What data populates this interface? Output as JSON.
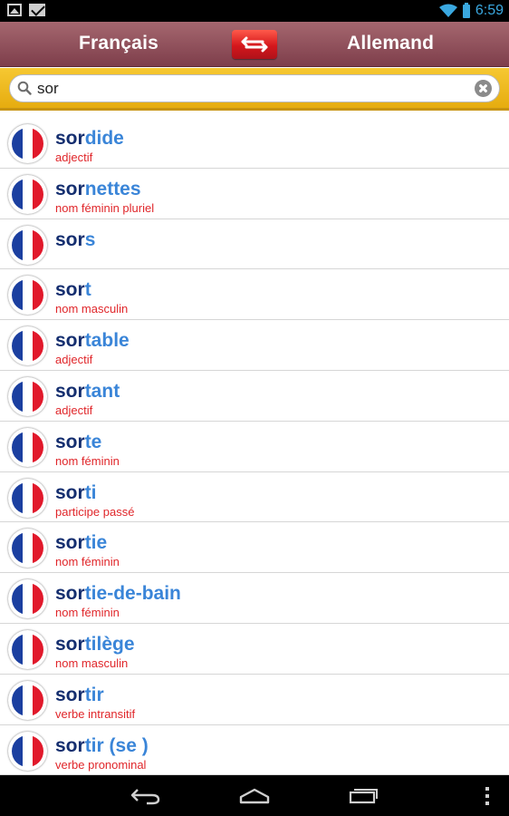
{
  "status_bar": {
    "time": "6:59"
  },
  "header": {
    "source_language": "Français",
    "target_language": "Allemand"
  },
  "search": {
    "query": "sor"
  },
  "results": [
    {
      "prefix": "sor",
      "rest": "dide",
      "pos": "adjectif"
    },
    {
      "prefix": "sor",
      "rest": "nettes",
      "pos": "nom féminin pluriel"
    },
    {
      "prefix": "sor",
      "rest": "s",
      "pos": ""
    },
    {
      "prefix": "sor",
      "rest": "t",
      "pos": "nom masculin"
    },
    {
      "prefix": "sor",
      "rest": "table",
      "pos": "adjectif"
    },
    {
      "prefix": "sor",
      "rest": "tant",
      "pos": "adjectif"
    },
    {
      "prefix": "sor",
      "rest": "te",
      "pos": "nom féminin"
    },
    {
      "prefix": "sor",
      "rest": "ti",
      "pos": "participe passé"
    },
    {
      "prefix": "sor",
      "rest": "tie",
      "pos": "nom féminin"
    },
    {
      "prefix": "sor",
      "rest": "tie-de-bain",
      "pos": "nom féminin"
    },
    {
      "prefix": "sor",
      "rest": "tilège",
      "pos": "nom masculin"
    },
    {
      "prefix": "sor",
      "rest": "tir",
      "pos": "verbe intransitif"
    },
    {
      "prefix": "sor",
      "rest": "tir (se )",
      "pos": "verbe pronominal"
    }
  ],
  "colors": {
    "header_top": "#a5676f",
    "header_bottom": "#7e3e4b",
    "search_bar": "#f6c832",
    "swap_button": "#d4171c",
    "query_match": "#142e6f",
    "word_rest": "#3a85d8",
    "part_of_speech": "#e0262a",
    "status_accent": "#3aa8e0"
  }
}
